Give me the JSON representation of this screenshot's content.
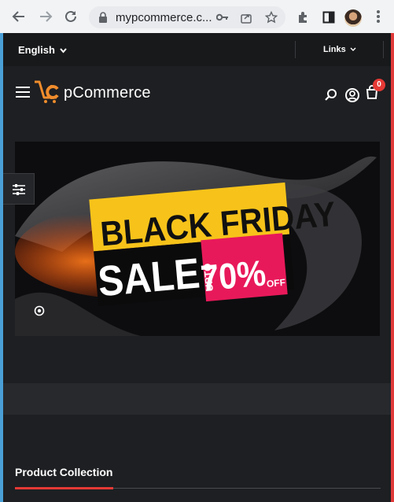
{
  "browser": {
    "url": "mypcommerce.c..."
  },
  "topbar": {
    "language": "English",
    "links": "Links"
  },
  "header": {
    "brand": "pCommerce",
    "cart_count": "0"
  },
  "banner": {
    "line1": "BLACK FRIDAY",
    "line2": "SALE",
    "upto": "UPTO",
    "percent": "70%",
    "off": "OFF"
  },
  "section": {
    "title": "Product Collection"
  },
  "colors": {
    "accent": "#e53935",
    "brand_orange": "#f08c2c",
    "banner_yellow": "#f7c31a",
    "banner_pink": "#e8195a"
  }
}
